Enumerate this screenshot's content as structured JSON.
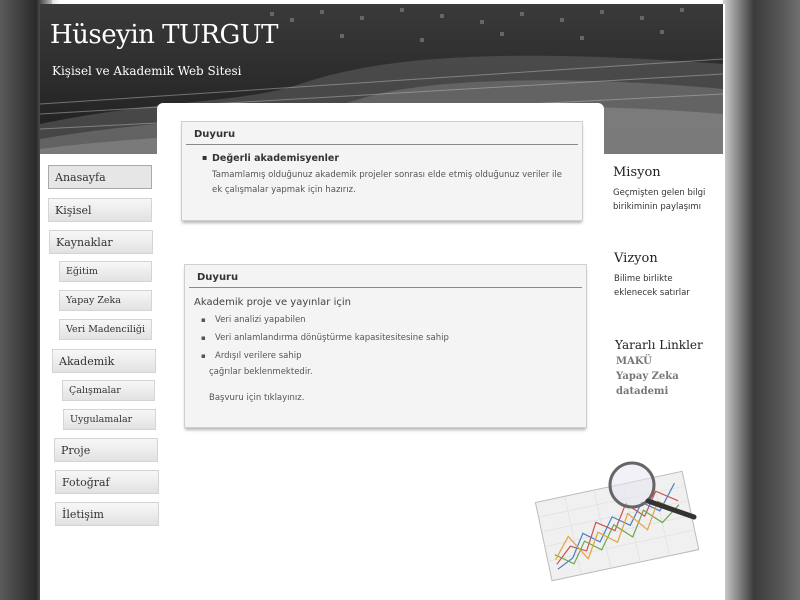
{
  "header": {
    "title": "Hüseyin TURGUT",
    "subtitle": "Kişisel ve Akademik Web Sitesi"
  },
  "nav": {
    "items": [
      {
        "label": "Anasayfa",
        "active": true
      },
      {
        "label": "Kişisel"
      },
      {
        "label": "Kaynaklar"
      },
      {
        "label": "Eğitim",
        "sub": true
      },
      {
        "label": "Yapay Zeka",
        "sub": true
      },
      {
        "label": "Veri Madenciliği",
        "sub": true
      },
      {
        "label": "Akademik"
      },
      {
        "label": "Çalışmalar",
        "sub": true
      },
      {
        "label": "Uygulamalar",
        "sub": true
      },
      {
        "label": "Proje"
      },
      {
        "label": "Fotoğraf"
      },
      {
        "label": "İletişim"
      }
    ]
  },
  "announcement1": {
    "title": "Duyuru",
    "heading": "Değerli akademisyenler",
    "text": "Tamamlamış olduğunuz akademik projeler sonrası elde etmiş olduğunuz veriler ile ek çalışmalar yapmak için hazırız."
  },
  "announcement2": {
    "title": "Duyuru",
    "intro": "Akademik proje ve yayınlar için",
    "bullets": [
      "Veri analizi yapabilen",
      "Veri anlamlandırma dönüştürme kapasitesitesine sahip",
      "Ardışıl verilere sahip"
    ],
    "note": "çağrılar beklenmektedir.",
    "link": "Başvuru için tıklayınız."
  },
  "sidebar": {
    "mission_title": "Misyon",
    "mission_text": "Geçmişten gelen bilgi birikiminin paylaşımı",
    "vision_title": "Vizyon",
    "vision_text": "Bilime birlikte eklenecek satırlar",
    "links_title": "Yararlı Linkler",
    "links": [
      "MAKÜ",
      "Yapay Zeka",
      "datademi"
    ]
  },
  "colors": {
    "header_bg": "#2b2b2b",
    "box_bg": "#f4f4f4",
    "link": "#777777"
  }
}
